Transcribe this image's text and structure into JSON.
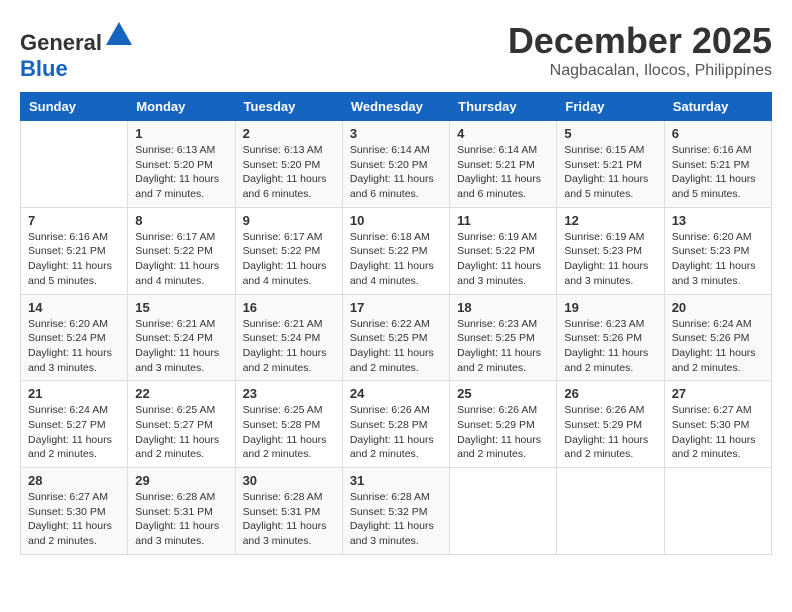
{
  "logo": {
    "text_general": "General",
    "text_blue": "Blue"
  },
  "header": {
    "month": "December 2025",
    "location": "Nagbacalan, Ilocos, Philippines"
  },
  "weekdays": [
    "Sunday",
    "Monday",
    "Tuesday",
    "Wednesday",
    "Thursday",
    "Friday",
    "Saturday"
  ],
  "weeks": [
    [
      {
        "day": "",
        "info": ""
      },
      {
        "day": "1",
        "info": "Sunrise: 6:13 AM\nSunset: 5:20 PM\nDaylight: 11 hours\nand 7 minutes."
      },
      {
        "day": "2",
        "info": "Sunrise: 6:13 AM\nSunset: 5:20 PM\nDaylight: 11 hours\nand 6 minutes."
      },
      {
        "day": "3",
        "info": "Sunrise: 6:14 AM\nSunset: 5:20 PM\nDaylight: 11 hours\nand 6 minutes."
      },
      {
        "day": "4",
        "info": "Sunrise: 6:14 AM\nSunset: 5:21 PM\nDaylight: 11 hours\nand 6 minutes."
      },
      {
        "day": "5",
        "info": "Sunrise: 6:15 AM\nSunset: 5:21 PM\nDaylight: 11 hours\nand 5 minutes."
      },
      {
        "day": "6",
        "info": "Sunrise: 6:16 AM\nSunset: 5:21 PM\nDaylight: 11 hours\nand 5 minutes."
      }
    ],
    [
      {
        "day": "7",
        "info": "Sunrise: 6:16 AM\nSunset: 5:21 PM\nDaylight: 11 hours\nand 5 minutes."
      },
      {
        "day": "8",
        "info": "Sunrise: 6:17 AM\nSunset: 5:22 PM\nDaylight: 11 hours\nand 4 minutes."
      },
      {
        "day": "9",
        "info": "Sunrise: 6:17 AM\nSunset: 5:22 PM\nDaylight: 11 hours\nand 4 minutes."
      },
      {
        "day": "10",
        "info": "Sunrise: 6:18 AM\nSunset: 5:22 PM\nDaylight: 11 hours\nand 4 minutes."
      },
      {
        "day": "11",
        "info": "Sunrise: 6:19 AM\nSunset: 5:22 PM\nDaylight: 11 hours\nand 3 minutes."
      },
      {
        "day": "12",
        "info": "Sunrise: 6:19 AM\nSunset: 5:23 PM\nDaylight: 11 hours\nand 3 minutes."
      },
      {
        "day": "13",
        "info": "Sunrise: 6:20 AM\nSunset: 5:23 PM\nDaylight: 11 hours\nand 3 minutes."
      }
    ],
    [
      {
        "day": "14",
        "info": "Sunrise: 6:20 AM\nSunset: 5:24 PM\nDaylight: 11 hours\nand 3 minutes."
      },
      {
        "day": "15",
        "info": "Sunrise: 6:21 AM\nSunset: 5:24 PM\nDaylight: 11 hours\nand 3 minutes."
      },
      {
        "day": "16",
        "info": "Sunrise: 6:21 AM\nSunset: 5:24 PM\nDaylight: 11 hours\nand 2 minutes."
      },
      {
        "day": "17",
        "info": "Sunrise: 6:22 AM\nSunset: 5:25 PM\nDaylight: 11 hours\nand 2 minutes."
      },
      {
        "day": "18",
        "info": "Sunrise: 6:23 AM\nSunset: 5:25 PM\nDaylight: 11 hours\nand 2 minutes."
      },
      {
        "day": "19",
        "info": "Sunrise: 6:23 AM\nSunset: 5:26 PM\nDaylight: 11 hours\nand 2 minutes."
      },
      {
        "day": "20",
        "info": "Sunrise: 6:24 AM\nSunset: 5:26 PM\nDaylight: 11 hours\nand 2 minutes."
      }
    ],
    [
      {
        "day": "21",
        "info": "Sunrise: 6:24 AM\nSunset: 5:27 PM\nDaylight: 11 hours\nand 2 minutes."
      },
      {
        "day": "22",
        "info": "Sunrise: 6:25 AM\nSunset: 5:27 PM\nDaylight: 11 hours\nand 2 minutes."
      },
      {
        "day": "23",
        "info": "Sunrise: 6:25 AM\nSunset: 5:28 PM\nDaylight: 11 hours\nand 2 minutes."
      },
      {
        "day": "24",
        "info": "Sunrise: 6:26 AM\nSunset: 5:28 PM\nDaylight: 11 hours\nand 2 minutes."
      },
      {
        "day": "25",
        "info": "Sunrise: 6:26 AM\nSunset: 5:29 PM\nDaylight: 11 hours\nand 2 minutes."
      },
      {
        "day": "26",
        "info": "Sunrise: 6:26 AM\nSunset: 5:29 PM\nDaylight: 11 hours\nand 2 minutes."
      },
      {
        "day": "27",
        "info": "Sunrise: 6:27 AM\nSunset: 5:30 PM\nDaylight: 11 hours\nand 2 minutes."
      }
    ],
    [
      {
        "day": "28",
        "info": "Sunrise: 6:27 AM\nSunset: 5:30 PM\nDaylight: 11 hours\nand 2 minutes."
      },
      {
        "day": "29",
        "info": "Sunrise: 6:28 AM\nSunset: 5:31 PM\nDaylight: 11 hours\nand 3 minutes."
      },
      {
        "day": "30",
        "info": "Sunrise: 6:28 AM\nSunset: 5:31 PM\nDaylight: 11 hours\nand 3 minutes."
      },
      {
        "day": "31",
        "info": "Sunrise: 6:28 AM\nSunset: 5:32 PM\nDaylight: 11 hours\nand 3 minutes."
      },
      {
        "day": "",
        "info": ""
      },
      {
        "day": "",
        "info": ""
      },
      {
        "day": "",
        "info": ""
      }
    ]
  ]
}
